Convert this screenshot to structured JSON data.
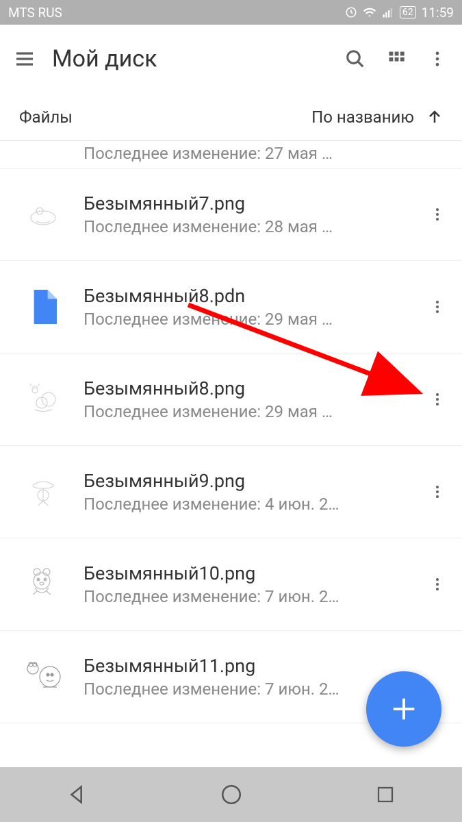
{
  "status_bar": {
    "carrier": "MTS RUS",
    "battery": "62",
    "time": "11:59"
  },
  "app_bar": {
    "title": "Мой диск"
  },
  "sort_bar": {
    "section": "Файлы",
    "sort_label": "По названию"
  },
  "files": [
    {
      "name": "",
      "meta": "Последнее изменение: 27 мая …",
      "thumb_type": "sketch",
      "partial": true
    },
    {
      "name": "Безымянный7.png",
      "meta": "Последнее изменение: 28 мая …",
      "thumb_type": "sketch"
    },
    {
      "name": "Безымянный8.pdn",
      "meta": "Последнее изменение: 29 мая …",
      "thumb_type": "doc"
    },
    {
      "name": "Безымянный8.png",
      "meta": "Последнее изменение: 29 мая …",
      "thumb_type": "sketch"
    },
    {
      "name": "Безымянный9.png",
      "meta": "Последнее изменение: 4 июн. 2…",
      "thumb_type": "sketch"
    },
    {
      "name": "Безымянный10.png",
      "meta": "Последнее изменение: 7 июн. 2…",
      "thumb_type": "sketch"
    },
    {
      "name": "Безымянный11.png",
      "meta": "Последнее изменение: 7 июн. 2…",
      "thumb_type": "sketch"
    }
  ]
}
